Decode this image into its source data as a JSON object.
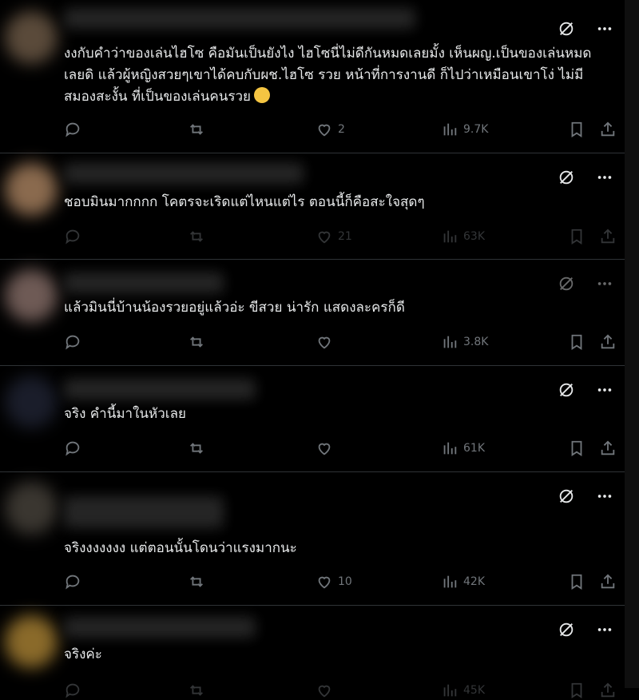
{
  "posts": [
    {
      "text": "งงกับคำว่าของเล่นไฮโซ คือมันเป็นยังไง ไฮโซนี่ไม่ดีกันหมดเลยมั้ง เห็นผญ.เป็นของเล่นหมดเลยดิ แล้วผู้หญิงสวยๆเขาได้คบกับผช.ไฮโซ รวย หน้าที่การงานดี ก็ไปว่าเหมือนเขาโง่ ไม่มีสมองสะงั้น ที่เป็นของเล่นคนรวย",
      "emoji": "relieved-face-emoji",
      "likes": "2",
      "views": "9.7K"
    },
    {
      "text": "ชอบมินมากกกก โคตรจะเริดแต่ไหนแต่ไร ตอนนี้ก็คือสะใจสุดๆ",
      "likes": "21",
      "views": "63K"
    },
    {
      "text": "แล้วมินนี่บ้านน้องรวยอยู่แล้วอ่ะ ขีสวย น่ารัก แสดงละครก็ดี",
      "likes": "",
      "views": "3.8K"
    },
    {
      "text": "จริง คำนี้มาในหัวเลย",
      "likes": "",
      "views": "61K"
    },
    {
      "text": "จริงงงงงงง แต่ตอนนั้นโดนว่าแรงมากนะ",
      "likes": "10",
      "views": "42K"
    },
    {
      "text": "จริงค่ะ",
      "likes": "",
      "views": "45K"
    }
  ]
}
